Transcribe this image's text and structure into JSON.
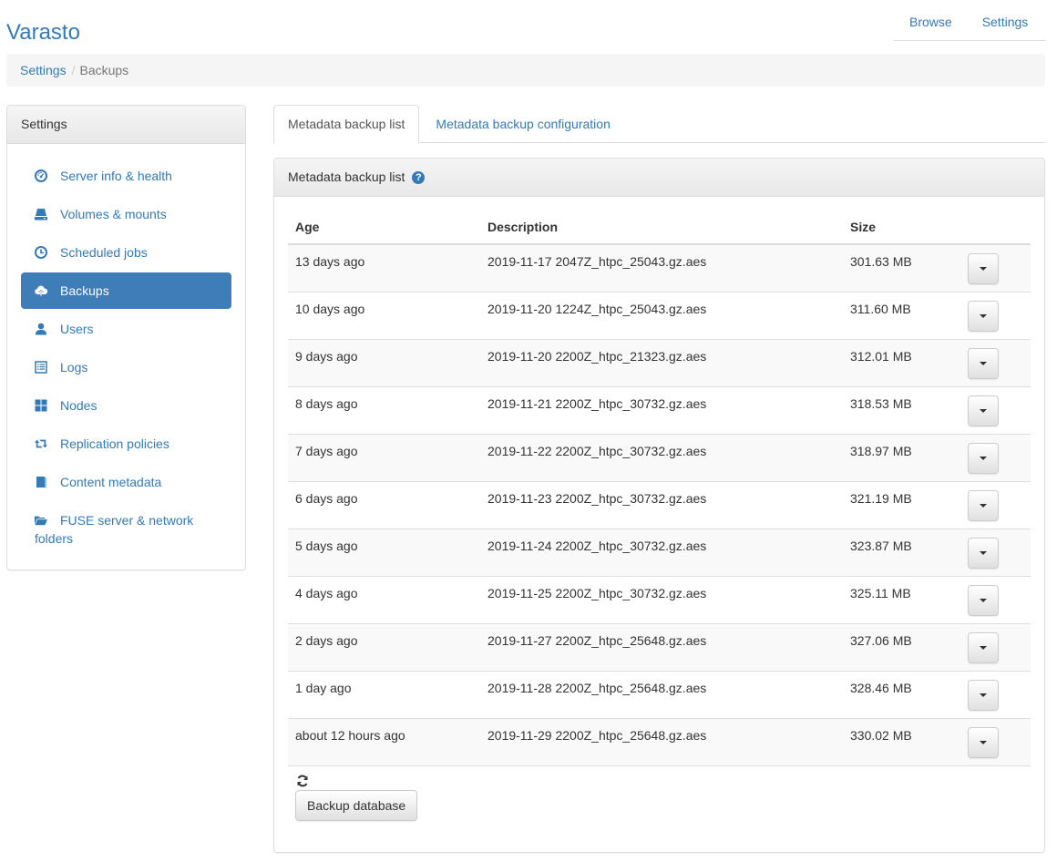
{
  "app": {
    "title": "Varasto"
  },
  "topnav": {
    "items": [
      {
        "label": "Browse"
      },
      {
        "label": "Settings"
      }
    ]
  },
  "breadcrumb": {
    "items": [
      {
        "label": "Settings"
      },
      {
        "label": "Backups"
      }
    ],
    "separator": "/"
  },
  "sidebar": {
    "heading": "Settings",
    "items": [
      {
        "label": "Server info & health",
        "icon": "dashboard-icon"
      },
      {
        "label": "Volumes & mounts",
        "icon": "hdd-icon"
      },
      {
        "label": "Scheduled jobs",
        "icon": "clock-icon"
      },
      {
        "label": "Backups",
        "icon": "cloud-upload-icon",
        "active": true
      },
      {
        "label": "Users",
        "icon": "user-icon"
      },
      {
        "label": "Logs",
        "icon": "list-alt-icon"
      },
      {
        "label": "Nodes",
        "icon": "th-large-icon"
      },
      {
        "label": "Replication policies",
        "icon": "retweet-icon"
      },
      {
        "label": "Content metadata",
        "icon": "book-icon"
      },
      {
        "label": "FUSE server & network folders",
        "icon": "folder-open-icon"
      }
    ]
  },
  "tabs": [
    {
      "label": "Metadata backup list",
      "active": true
    },
    {
      "label": "Metadata backup configuration",
      "active": false
    }
  ],
  "panel": {
    "title": "Metadata backup list",
    "help_icon": "?",
    "columns": {
      "age": "Age",
      "description": "Description",
      "size": "Size"
    },
    "rows": [
      {
        "age": "13 days ago",
        "description": "2019-11-17 2047Z_htpc_25043.gz.aes",
        "size": "301.63 MB"
      },
      {
        "age": "10 days ago",
        "description": "2019-11-20 1224Z_htpc_25043.gz.aes",
        "size": "311.60 MB"
      },
      {
        "age": "9 days ago",
        "description": "2019-11-20 2200Z_htpc_21323.gz.aes",
        "size": "312.01 MB"
      },
      {
        "age": "8 days ago",
        "description": "2019-11-21 2200Z_htpc_30732.gz.aes",
        "size": "318.53 MB"
      },
      {
        "age": "7 days ago",
        "description": "2019-11-22 2200Z_htpc_30732.gz.aes",
        "size": "318.97 MB"
      },
      {
        "age": "6 days ago",
        "description": "2019-11-23 2200Z_htpc_30732.gz.aes",
        "size": "321.19 MB"
      },
      {
        "age": "5 days ago",
        "description": "2019-11-24 2200Z_htpc_30732.gz.aes",
        "size": "323.87 MB"
      },
      {
        "age": "4 days ago",
        "description": "2019-11-25 2200Z_htpc_30732.gz.aes",
        "size": "325.11 MB"
      },
      {
        "age": "2 days ago",
        "description": "2019-11-27 2200Z_htpc_25648.gz.aes",
        "size": "327.06 MB"
      },
      {
        "age": "1 day ago",
        "description": "2019-11-28 2200Z_htpc_25648.gz.aes",
        "size": "328.46 MB"
      },
      {
        "age": "about 12 hours ago",
        "description": "2019-11-29 2200Z_htpc_25648.gz.aes",
        "size": "330.02 MB"
      }
    ],
    "backup_button": "Backup database"
  },
  "colors": {
    "accent": "#337ab7",
    "active_item": "#3f7db8",
    "text": "#333333",
    "stripe": "#f9f9f9"
  }
}
